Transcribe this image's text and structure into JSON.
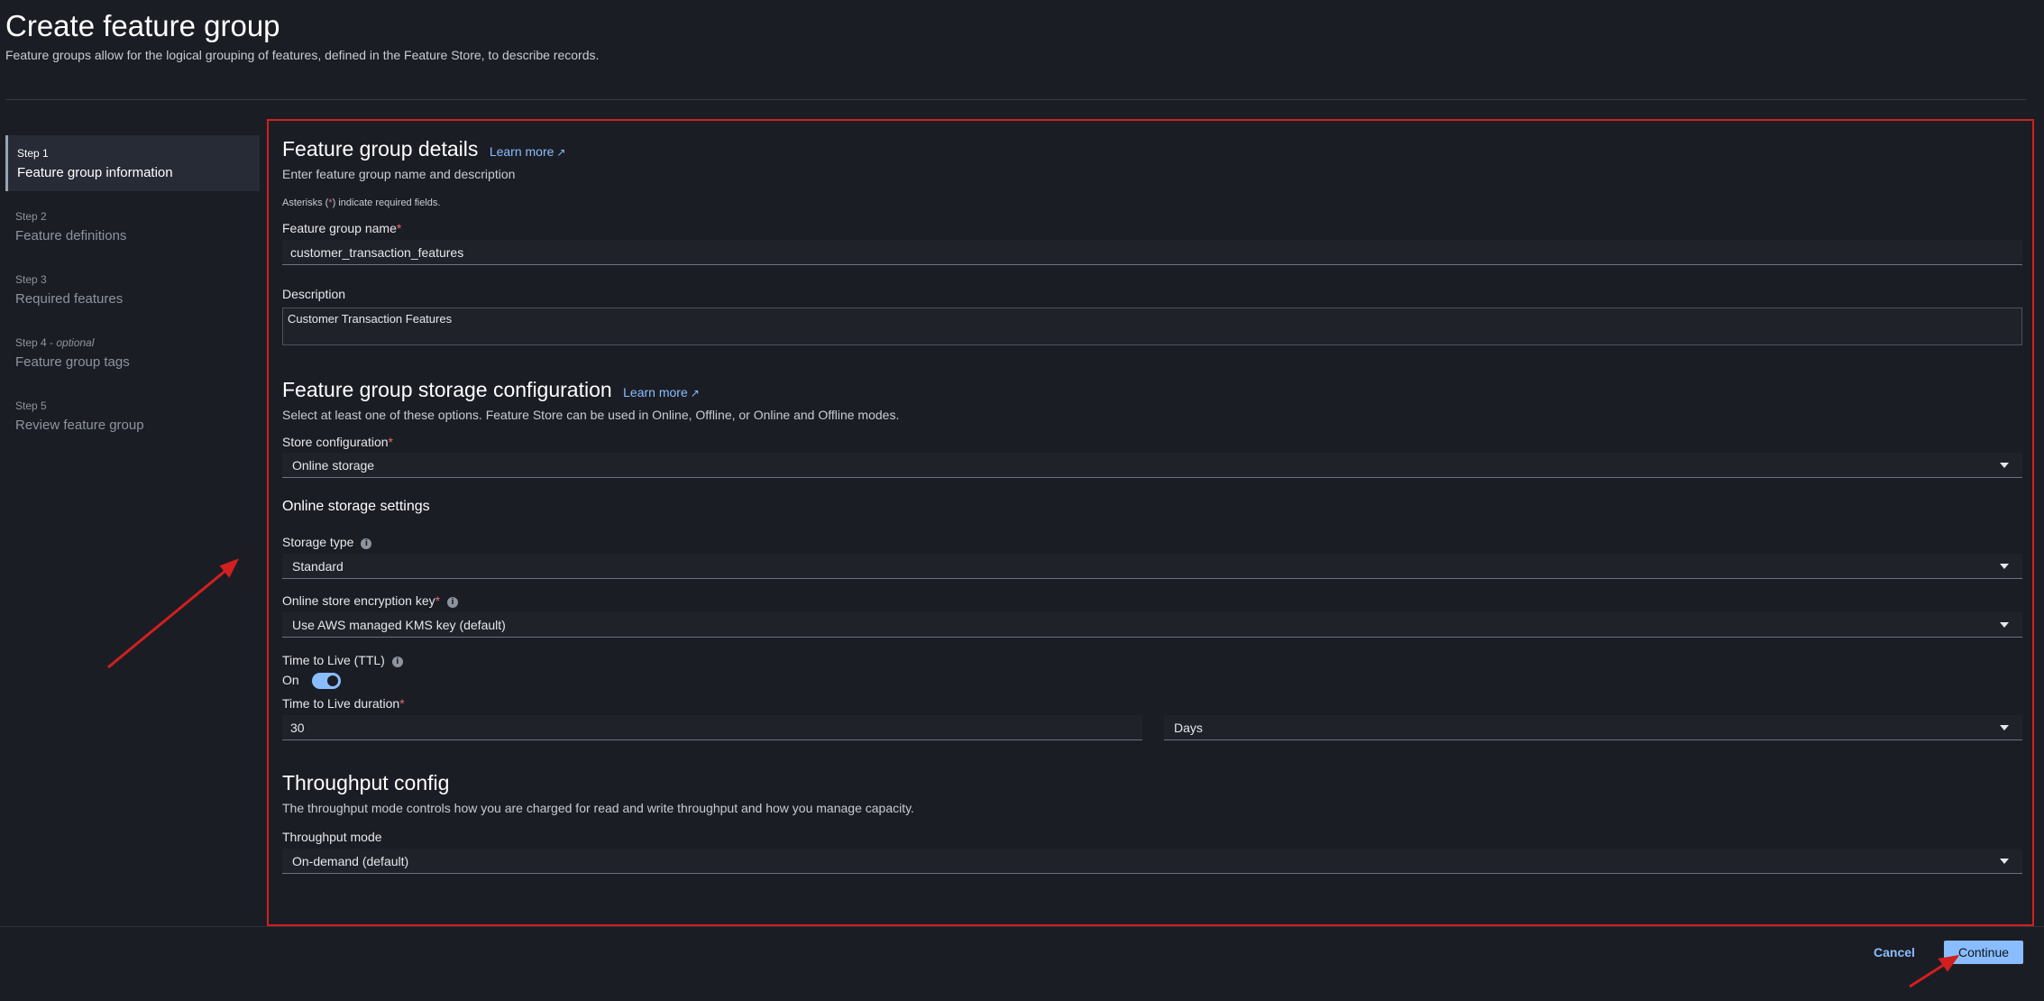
{
  "header": {
    "title": "Create feature group",
    "subtitle": "Feature groups allow for the logical grouping of features, defined in the Feature Store, to describe records."
  },
  "steps": [
    {
      "num": "Step 1",
      "optional": "",
      "label": "Feature group information",
      "active": true
    },
    {
      "num": "Step 2",
      "optional": "",
      "label": "Feature definitions",
      "active": false
    },
    {
      "num": "Step 3",
      "optional": "",
      "label": "Required features",
      "active": false
    },
    {
      "num": "Step 4 - ",
      "optional": "optional",
      "label": "Feature group tags",
      "active": false
    },
    {
      "num": "Step 5",
      "optional": "",
      "label": "Review feature group",
      "active": false
    }
  ],
  "details": {
    "heading": "Feature group details",
    "learn_more": "Learn more",
    "description": "Enter feature group name and description",
    "note_prefix": "Asterisks (",
    "note_star": "*",
    "note_suffix": ") indicate required fields.",
    "name_label": "Feature group name",
    "name_value": "customer_transaction_features",
    "desc_label": "Description",
    "desc_value": "Customer Transaction Features"
  },
  "storage": {
    "heading": "Feature group storage configuration",
    "learn_more": "Learn more",
    "description": "Select at least one of these options. Feature Store can be used in Online, Offline, or Online and Offline modes.",
    "store_config_label": "Store configuration",
    "store_config_value": "Online storage",
    "online_settings_heading": "Online storage settings",
    "storage_type_label": "Storage type",
    "storage_type_value": "Standard",
    "encryption_label": "Online store encryption key",
    "encryption_value": "Use AWS managed KMS key (default)",
    "ttl_label": "Time to Live (TTL)",
    "ttl_toggle_label": "On",
    "ttl_toggle_on": true,
    "ttl_duration_label": "Time to Live duration",
    "ttl_duration_value": "30",
    "ttl_unit_value": "Days"
  },
  "throughput": {
    "heading": "Throughput config",
    "description": "The throughput mode controls how you are charged for read and write throughput and how you manage capacity.",
    "mode_label": "Throughput mode",
    "mode_value": "On-demand (default)"
  },
  "footer": {
    "cancel_label": "Cancel",
    "continue_label": "Continue"
  },
  "colors": {
    "accent": "#89bdff",
    "annotation": "#d21f1f",
    "required": "#e46b6b"
  },
  "icons": {
    "info": "info-icon",
    "external_link": "external-link-icon",
    "caret": "caret-down-icon"
  }
}
